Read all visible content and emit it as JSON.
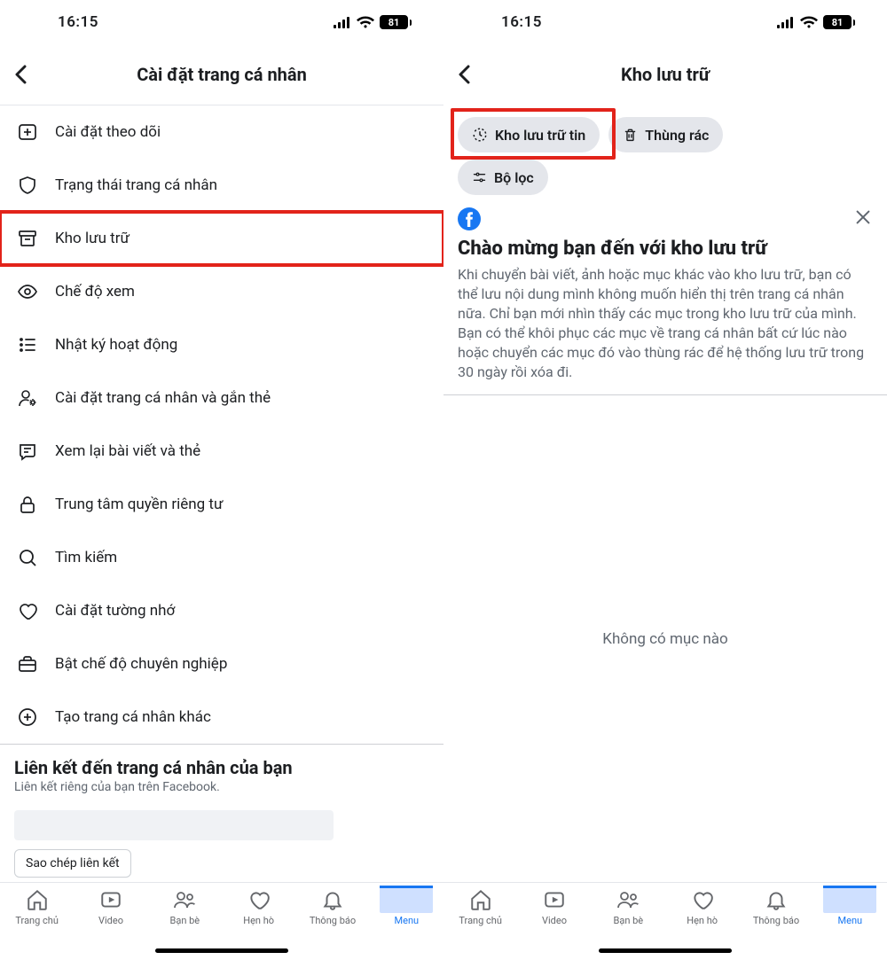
{
  "status": {
    "time": "16:15",
    "battery": "81"
  },
  "left": {
    "title": "Cài đặt trang cá nhân",
    "items": [
      {
        "icon": "follow",
        "label": "Cài đặt theo dõi"
      },
      {
        "icon": "shield",
        "label": "Trạng thái trang cá nhân"
      },
      {
        "icon": "archive",
        "label": "Kho lưu trữ",
        "highlight": true
      },
      {
        "icon": "eye",
        "label": "Chế độ xem"
      },
      {
        "icon": "list",
        "label": "Nhật ký hoạt động"
      },
      {
        "icon": "user-gear",
        "label": "Cài đặt trang cá nhân và gắn thẻ"
      },
      {
        "icon": "review",
        "label": "Xem lại bài viết và thẻ"
      },
      {
        "icon": "lock",
        "label": "Trung tâm quyền riêng tư"
      },
      {
        "icon": "search",
        "label": "Tìm kiếm"
      },
      {
        "icon": "heart",
        "label": "Cài đặt tường nhớ"
      },
      {
        "icon": "briefcase",
        "label": "Bật chế độ chuyên nghiệp"
      },
      {
        "icon": "plus-circle",
        "label": "Tạo trang cá nhân khác"
      }
    ],
    "link_section": {
      "title": "Liên kết đến trang cá nhân của bạn",
      "subtitle": "Liên kết riêng của bạn trên Facebook.",
      "copy": "Sao chép liên kết"
    }
  },
  "right": {
    "title": "Kho lưu trữ",
    "pills": {
      "story_archive": "Kho lưu trữ tin",
      "trash": "Thùng rác",
      "filter": "Bộ lọc"
    },
    "info": {
      "heading": "Chào mừng bạn đến với kho lưu trữ",
      "body": "Khi chuyển bài viết, ảnh hoặc mục khác vào kho lưu trữ, bạn có thể lưu nội dung mình không muốn hiển thị trên trang cá nhân nữa. Chỉ bạn mới nhìn thấy các mục trong kho lưu trữ của mình. Bạn có thể khôi phục các mục về trang cá nhân bất cứ lúc nào hoặc chuyển các mục đó vào thùng rác để hệ thống lưu trữ trong 30 ngày rồi xóa đi."
    },
    "empty": "Không có mục nào"
  },
  "nav": {
    "home": "Trang chủ",
    "video": "Video",
    "friends": "Bạn bè",
    "dating": "Hẹn hò",
    "notifications": "Thông báo",
    "menu": "Menu"
  }
}
